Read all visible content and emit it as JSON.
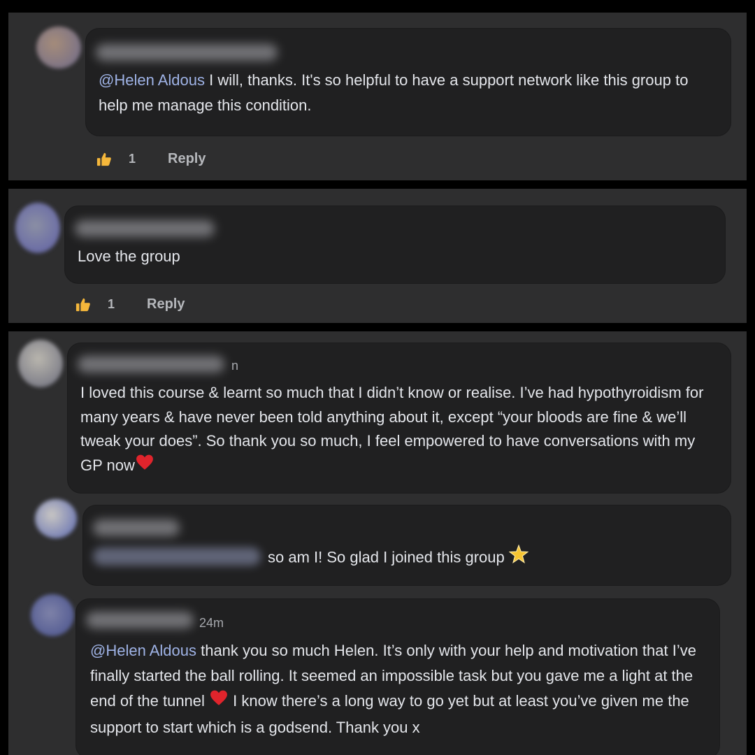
{
  "comments": [
    {
      "mention": "@Helen Aldous",
      "text": " I will, thanks. It's so helpful to have a support network like this group to help me manage this condition.",
      "like_count": "1",
      "reply_label": "Reply"
    },
    {
      "text": "Love the group",
      "like_count": "1",
      "reply_label": "Reply"
    },
    {
      "name_suffix": "n",
      "text": "I loved this course & learnt so much that I didn’t know or realise. I’ve had hypothyroidism for many years & have never been told anything about it, except “your bloods are fine & we’ll tweak your does”. So thank you so much, I feel empowered to have conversations with my GP now"
    },
    {
      "text": "so am I! So glad I joined this group"
    },
    {
      "time": "24m",
      "mention": "@Helen Aldous",
      "text_a": " thank you so much Helen. It’s only with your help and motivation that I’ve finally started the ball rolling. It seemed an impossible task but you gave me a light at the end of the tunnel ",
      "text_b": " I know there’s a long way to go yet but at least you’ve given me the support to start which is a godsend. Thank you x"
    }
  ],
  "icons": {
    "like": "thumbs-up-icon",
    "heart": "red-heart-emoji",
    "star": "glowing-star-emoji"
  },
  "colors": {
    "panel_bg": "#2e2e2f",
    "bubble_bg": "#202021",
    "mention": "#9fb3e6",
    "text": "#e4e6eb",
    "like": "#f5b73b"
  }
}
